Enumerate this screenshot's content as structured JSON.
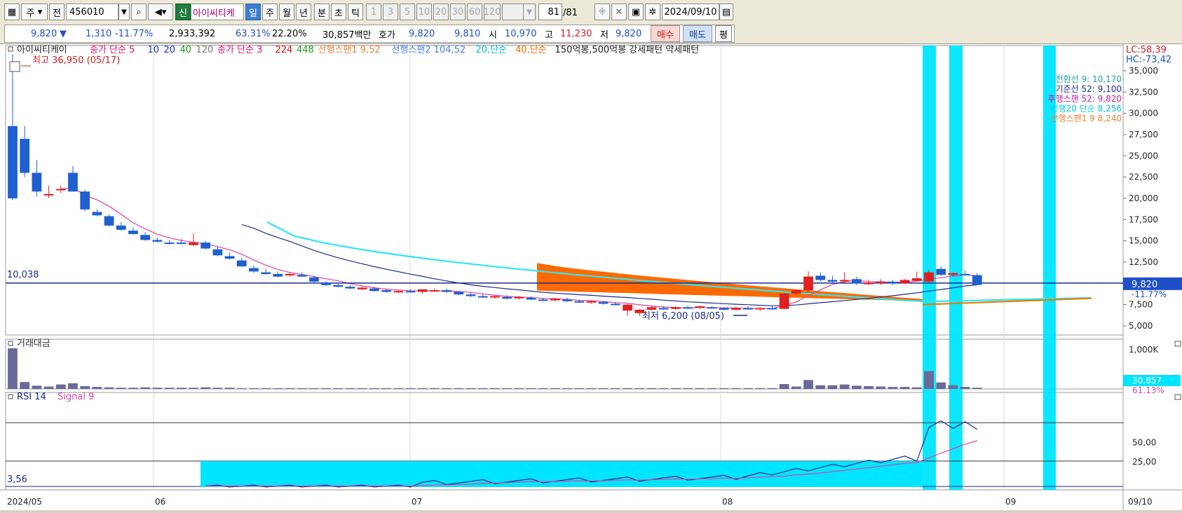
{
  "toolbar": {
    "market_label": "주",
    "prefix_label": "전",
    "code": "456010",
    "shin_label": "신",
    "stock_name": "아이씨티케",
    "periods": [
      "일",
      "주",
      "월",
      "년"
    ],
    "active_period": "일",
    "intraday": [
      "분",
      "초",
      "틱"
    ],
    "intervals": [
      "1",
      "3",
      "5",
      "10",
      "20",
      "30",
      "60",
      "120"
    ],
    "count": "81",
    "count_total": "/81",
    "date": "2024/09/10"
  },
  "quote": {
    "price": "9,820",
    "direction": "▼",
    "change": "1,310",
    "change_pct": "-11.77%",
    "volume": "2,933,392",
    "vol_ratio1": "63.31%",
    "vol_ratio2": "22.20%",
    "turnover": "30,857백만",
    "hoga_label": "호가",
    "ask": "9,820",
    "bid": "9,810",
    "open_label": "시",
    "open": "10,970",
    "high_label": "고",
    "high": "11,230",
    "low_label": "저",
    "low": "9,820",
    "buy_label": "매수",
    "sell_label": "매도",
    "avg_label": "평"
  },
  "colors": {
    "up": "#e02020",
    "down": "#1f5fd0",
    "cyan": "#00e5ff",
    "cloud": "#ff6a00",
    "ma5": "#e040a0",
    "ma10": "#1b2a8c"
  },
  "price_panel": {
    "stock_tag": "아이씨티케이",
    "legend": [
      {
        "text": "종가 단순 5",
        "color": "#e0106a"
      },
      {
        "text": "10",
        "color": "#1e2fd0"
      },
      {
        "text": "20",
        "color": "#1e2fd0"
      },
      {
        "text": "40",
        "color": "#18a018"
      },
      {
        "text": "120",
        "color": "#7a7a7a"
      },
      {
        "text": "종가 단순 3",
        "color": "#e0106a"
      },
      {
        "text": "224",
        "color": "#e01010"
      },
      {
        "text": "448",
        "color": "#18a018"
      },
      {
        "text": "선행스팬1 9,52",
        "color": "#f08030"
      },
      {
        "text": "선행스팬2 104,52",
        "color": "#4c7fe0"
      },
      {
        "text": "20,단순",
        "color": "#00c0e0"
      },
      {
        "text": "40,단순",
        "color": "#f07000"
      },
      {
        "text": "150억봉,500억봉 강세패턴  약세패턴",
        "color": "#222222"
      }
    ],
    "high_annotation": "최고 36,950 (05/17)",
    "low_annotation": "최저 6,200 (08/05)",
    "ref_label": "10,038",
    "y_ticks": [
      "35,000",
      "32,500",
      "30,000",
      "27,500",
      "25,000",
      "22,500",
      "20,000",
      "17,500",
      "15,000",
      "12,500",
      "7,500",
      "5,000"
    ],
    "lc": "LC:58,39",
    "hc": "HC:-73,42",
    "ichimoku_labels": [
      {
        "text": "전환선 9: 10,170",
        "color": "#20a0a0"
      },
      {
        "text": "기준선 52: 9,100",
        "color": "#1b2a8c"
      },
      {
        "text": "후행스팬 52: 9,820",
        "color": "#c020a0"
      },
      {
        "text": "선행20 단순 8,256",
        "color": "#00c8e8"
      },
      {
        "text": "선행스팬1 9 8,240",
        "color": "#f08030"
      }
    ],
    "price_tag": "9,820",
    "price_tag_pct": "-11.77%"
  },
  "volume_panel": {
    "title": "거래대금",
    "y_ticks": [
      "1,000K"
    ],
    "value_tag": "30,857",
    "pct_tag": "61.13%"
  },
  "rsi_panel": {
    "title": "RSI 14",
    "signal": "Signal 9",
    "y_ticks": [
      "50,00",
      "25,00"
    ],
    "value_label": "3,56"
  },
  "x_axis": {
    "labels": [
      "2024/05",
      "06",
      "07",
      "08",
      "09",
      "09/10"
    ]
  },
  "chart_data": {
    "type": "candlestick",
    "candles": [
      [
        28500,
        36950,
        19800,
        20000
      ],
      [
        27000,
        28500,
        22500,
        23000
      ],
      [
        23000,
        24500,
        20200,
        20800
      ],
      [
        20500,
        21500,
        20000,
        20500
      ],
      [
        21000,
        21500,
        20600,
        21100
      ],
      [
        23000,
        23800,
        20800,
        20800
      ],
      [
        20800,
        21000,
        18500,
        18700
      ],
      [
        18400,
        18700,
        17900,
        18000
      ],
      [
        17900,
        18100,
        16700,
        16800
      ],
      [
        16800,
        17200,
        16200,
        16300
      ],
      [
        16200,
        16600,
        15700,
        15800
      ],
      [
        15700,
        16000,
        15000,
        15100
      ],
      [
        15100,
        15400,
        14800,
        14900
      ],
      [
        14800,
        15100,
        14600,
        14700
      ],
      [
        14800,
        15200,
        14600,
        14700
      ],
      [
        14500,
        15900,
        14400,
        14800
      ],
      [
        14800,
        15000,
        14000,
        14100
      ],
      [
        14000,
        14300,
        13200,
        13300
      ],
      [
        13200,
        13600,
        12800,
        12900
      ],
      [
        12700,
        13000,
        11900,
        12000
      ],
      [
        11800,
        12100,
        11200,
        11400
      ],
      [
        11300,
        11700,
        11000,
        11100
      ],
      [
        11100,
        11400,
        10700,
        10800
      ],
      [
        11000,
        11300,
        10800,
        11100
      ],
      [
        11000,
        11300,
        10700,
        10800
      ],
      [
        10700,
        10900,
        10100,
        10200
      ],
      [
        10100,
        10300,
        9700,
        9800
      ],
      [
        9800,
        10000,
        9500,
        9600
      ],
      [
        9600,
        9800,
        9300,
        9400
      ],
      [
        9300,
        9600,
        9200,
        9500
      ],
      [
        9400,
        9600,
        9000,
        9100
      ],
      [
        9200,
        9400,
        8900,
        9000
      ],
      [
        9000,
        9200,
        8900,
        9100
      ],
      [
        9100,
        9300,
        8900,
        9000
      ],
      [
        9000,
        9200,
        8800,
        9300
      ],
      [
        9200,
        9400,
        9000,
        9200
      ],
      [
        9200,
        9400,
        8900,
        9000
      ],
      [
        9000,
        9100,
        8600,
        8700
      ],
      [
        8700,
        8900,
        8400,
        8500
      ],
      [
        8500,
        8700,
        8300,
        8400
      ],
      [
        8400,
        8600,
        8200,
        8500
      ],
      [
        8400,
        8600,
        8100,
        8200
      ],
      [
        8300,
        8500,
        8100,
        8400
      ],
      [
        8300,
        8500,
        8000,
        8100
      ],
      [
        8100,
        8300,
        7900,
        8000
      ],
      [
        8000,
        8300,
        7900,
        8200
      ],
      [
        8100,
        8300,
        7800,
        7900
      ],
      [
        7900,
        8100,
        7700,
        7800
      ],
      [
        7800,
        8000,
        7600,
        7900
      ],
      [
        7800,
        7900,
        7500,
        7600
      ],
      [
        7600,
        7800,
        7400,
        7500
      ],
      [
        6800,
        7600,
        6200,
        7500
      ],
      [
        6500,
        7000,
        6200,
        6900
      ],
      [
        6900,
        7300,
        6800,
        7200
      ],
      [
        7100,
        7300,
        6900,
        7000
      ],
      [
        7000,
        7300,
        6900,
        7200
      ],
      [
        7200,
        7400,
        7000,
        7100
      ],
      [
        7200,
        7400,
        7000,
        7300
      ],
      [
        7200,
        7300,
        7000,
        7100
      ],
      [
        7100,
        7200,
        6800,
        6900
      ],
      [
        6900,
        7200,
        6800,
        7100
      ],
      [
        7100,
        7300,
        6900,
        7000
      ],
      [
        7000,
        7200,
        6800,
        7100
      ],
      [
        7100,
        7300,
        6900,
        7000
      ],
      [
        7000,
        8900,
        6950,
        8800
      ],
      [
        8800,
        9300,
        8600,
        9200
      ],
      [
        9200,
        11400,
        9000,
        10800
      ],
      [
        10900,
        11300,
        10200,
        10400
      ],
      [
        10400,
        10900,
        10000,
        10200
      ],
      [
        10300,
        11300,
        10100,
        10400
      ],
      [
        10500,
        10800,
        9800,
        10000
      ],
      [
        9900,
        10400,
        9800,
        10100
      ],
      [
        10100,
        10500,
        9800,
        10200
      ],
      [
        10200,
        10400,
        9800,
        10000
      ],
      [
        10000,
        10500,
        9900,
        10400
      ],
      [
        10300,
        11400,
        10200,
        10600
      ],
      [
        10200,
        11600,
        10100,
        11300
      ],
      [
        11700,
        12000,
        10900,
        11000
      ],
      [
        11000,
        11300,
        10800,
        11200
      ],
      [
        11100,
        11500,
        10900,
        11000
      ],
      [
        10970,
        11230,
        9820,
        9820
      ]
    ],
    "high": {
      "date": "05/17",
      "value": 36950
    },
    "low": {
      "date": "08/05",
      "value": 6200
    },
    "last": 9820,
    "x_labels": [
      "2024/05",
      "06",
      "07",
      "08",
      "09",
      "09/10"
    ],
    "y_range": [
      4000,
      37000
    ],
    "rsi": {
      "period": 14,
      "signal": 9,
      "last": 3.56,
      "y_range": [
        0,
        100
      ]
    }
  }
}
